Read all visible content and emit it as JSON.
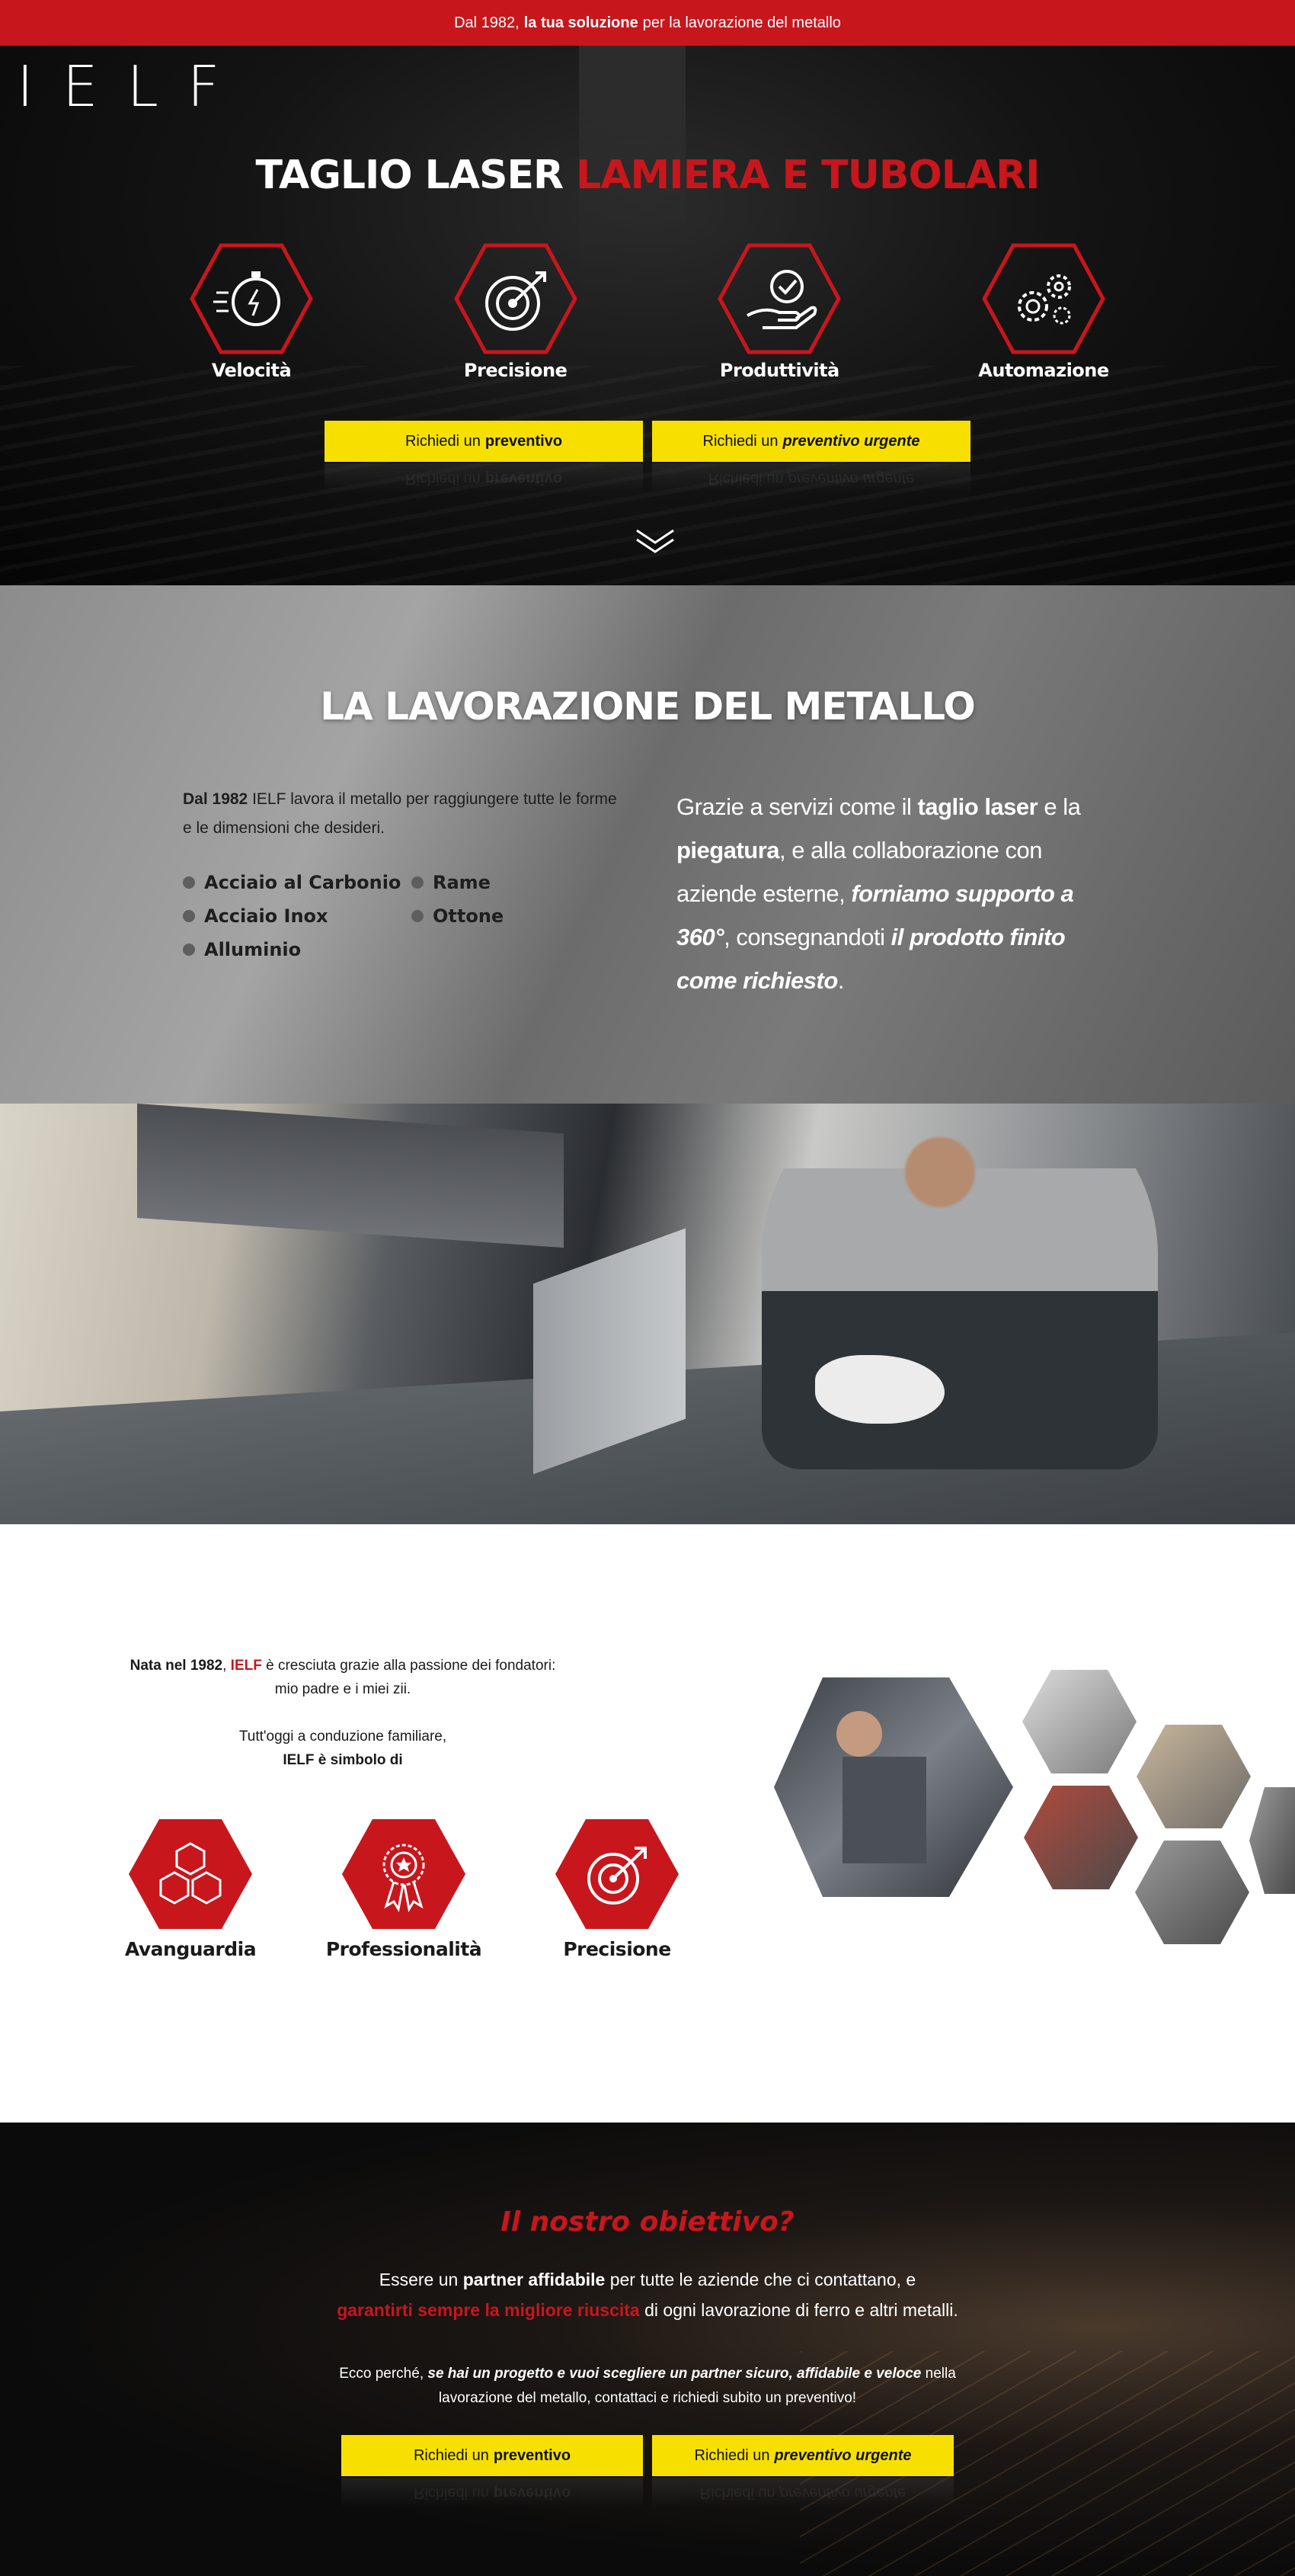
{
  "topbar": {
    "pre": "Dal 1982,",
    "highlight": "la tua soluzione",
    "post": "per la lavorazione del metallo"
  },
  "brand": {
    "logo": "IELF"
  },
  "hero": {
    "title_white": "TAGLIO LASER",
    "title_red": "LAMIERA E TUBOLARI",
    "features": [
      {
        "label": "Velocità",
        "icon": "stopwatch-icon"
      },
      {
        "label": "Precisione",
        "icon": "target-icon"
      },
      {
        "label": "Produttività",
        "icon": "hand-check-icon"
      },
      {
        "label": "Automazione",
        "icon": "gears-icon"
      }
    ],
    "btn_quote_pre": "Richiedi un",
    "btn_quote_bold": "preventivo",
    "btn_urgent_pre": "Richiedi un",
    "btn_urgent_bold": "preventivo urgente"
  },
  "metal": {
    "title": "LA LAVORAZIONE DEL METALLO",
    "intro_bold": "Dal 1982",
    "intro_rest": "IELF lavora il metallo per raggiungere tutte le forme e le dimensioni che desideri.",
    "materials": [
      "Acciaio al Carbonio",
      "Rame",
      "Acciaio Inox",
      "Ottone",
      "Alluminio"
    ],
    "right_1": "Grazie a servizi come il",
    "right_2": "taglio laser",
    "right_3": "e la",
    "right_4": "piegatura",
    "right_5": ", e alla collaborazione con aziende esterne,",
    "right_6": "forniamo supporto a 360°",
    "right_7": ", consegnandoti",
    "right_8": "il prodotto finito come richiesto",
    "right_9": "."
  },
  "about": {
    "line1_bold": "Nata nel 1982",
    "line1_comma": ",",
    "line1_red": "IELF",
    "line1_rest": "è cresciuta grazie alla passione dei fondatori:",
    "line2": "mio padre e i miei zii.",
    "line3": "Tutt'oggi a conduzione familiare,",
    "line4": "IELF è simbolo di",
    "values": [
      {
        "label": "Avanguardia",
        "icon": "hexagons-icon"
      },
      {
        "label": "Professionalità",
        "icon": "award-ribbon-icon"
      },
      {
        "label": "Precisione",
        "icon": "target-arrow-icon"
      }
    ]
  },
  "objective": {
    "title": "Il nostro obiettivo?",
    "p1_a": "Essere un",
    "p1_b": "partner affidabile",
    "p1_c": "per tutte le aziende che ci contattano, e",
    "p1_d": "garantirti sempre la migliore riuscita",
    "p1_e": "di ogni lavorazione di ferro e altri metalli.",
    "p2_a": "Ecco perché,",
    "p2_b": "se hai un progetto e vuoi scegliere un partner sicuro, affidabile e veloce",
    "p2_c": "nella lavorazione del metallo, contattaci e richiedi subito un preventivo!",
    "btn_quote_pre": "Richiedi un",
    "btn_quote_bold": "preventivo",
    "btn_urgent_pre": "Richiedi un",
    "btn_urgent_bold": "preventivo urgente"
  },
  "colors": {
    "brand_red": "#c8161d",
    "cta_yellow": "#f7e000"
  }
}
